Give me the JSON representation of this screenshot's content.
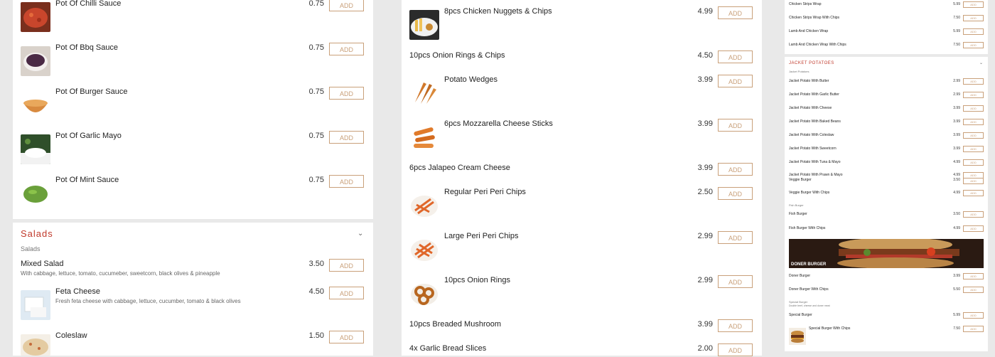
{
  "add_label": "ADD",
  "col1": {
    "sauces": [
      {
        "name": "Pot Of Chilli Sauce",
        "price": "0.75",
        "image": "chilli-sauce"
      },
      {
        "name": "Pot Of Bbq Sauce",
        "price": "0.75",
        "image": "bbq-sauce"
      },
      {
        "name": "Pot Of Burger Sauce",
        "price": "0.75",
        "image": "burger-sauce"
      },
      {
        "name": "Pot Of Garlic Mayo",
        "price": "0.75",
        "image": "garlic-mayo"
      },
      {
        "name": "Pot Of Mint Sauce",
        "price": "0.75",
        "image": "mint-sauce"
      }
    ],
    "salads": {
      "title": "Salads",
      "subtitle": "Salads",
      "items": [
        {
          "name": "Mixed Salad",
          "desc": "With cabbage, lettuce, tomato, cucumeber, sweetcorn, black olives & pineapple",
          "price": "3.50"
        },
        {
          "name": "Feta Cheese",
          "desc": "Fresh feta cheese with cabbage, lettuce, cucumber, tomato & black olives",
          "price": "4.50",
          "image": "feta"
        },
        {
          "name": "Coleslaw",
          "desc": "",
          "price": "1.50",
          "image": "coleslaw"
        }
      ]
    }
  },
  "col2": {
    "items": [
      {
        "name": "8pcs Chicken Nuggets & Chips",
        "price": "4.99",
        "image": "nuggets"
      },
      {
        "name": "10pcs Onion Rings & Chips",
        "price": "4.50"
      },
      {
        "name": "Potato Wedges",
        "price": "3.99",
        "image": "wedges"
      },
      {
        "name": "6pcs Mozzarella Cheese Sticks",
        "price": "3.99",
        "image": "mozzarella"
      },
      {
        "name": "6pcs Jalapeo Cream Cheese",
        "price": "3.99"
      },
      {
        "name": "Regular Peri Peri Chips",
        "price": "2.50",
        "image": "peri-chips"
      },
      {
        "name": "Large Peri Peri Chips",
        "price": "2.99",
        "image": "peri-chips-large"
      },
      {
        "name": "10pcs Onion Rings",
        "price": "2.99",
        "image": "onion-rings"
      },
      {
        "name": "10pcs Breaded Mushroom",
        "price": "3.99"
      },
      {
        "name": "4x Garlic Bread Slices",
        "price": "2.00"
      }
    ]
  },
  "col3": {
    "wraps": [
      {
        "name": "Chicken Strips Wrap",
        "price": "5.99"
      },
      {
        "name": "Chicken Strips Wrap With Chips",
        "price": "7.50"
      },
      {
        "name": "Lamb And Chicken Wrap",
        "price": "5.99"
      },
      {
        "name": "Lamb And Chicken Wrap With Chips",
        "price": "7.50"
      }
    ],
    "jacket": {
      "title": "JACKET POTATOES",
      "subtitle": "Jacket Potatoes",
      "items": [
        {
          "name": "Jacket Potato With Butter",
          "price": "2.99"
        },
        {
          "name": "Jacket Potato With Garlic Butter",
          "price": "2.99"
        },
        {
          "name": "Jacket Potato With Cheese",
          "price": "3.99"
        },
        {
          "name": "Jacket Potato With Baked Beans",
          "price": "3.99"
        },
        {
          "name": "Jacket Potato With Coleslaw",
          "price": "3.99"
        },
        {
          "name": "Jacket Potato With Sweetcorn",
          "price": "3.99"
        },
        {
          "name": "Jacket Potato With Tuna & Mayo",
          "price": "4.99"
        },
        {
          "name": "Jacket Potato With Prawn & Mayo",
          "price": "4.99"
        }
      ]
    },
    "burgers": {
      "veggie": [
        {
          "name": "Veggie Burger",
          "price": "3.50"
        },
        {
          "name": "Veggie Burger With Chips",
          "price": "4.99"
        }
      ],
      "fish_sub": "Fish Burger",
      "fish": [
        {
          "name": "Fish Burger",
          "price": "3.50"
        },
        {
          "name": "Fish Burger With Chips",
          "price": "4.99"
        }
      ],
      "banner": "DONER BURGER",
      "doner": [
        {
          "name": "Doner Burger",
          "price": "3.99"
        },
        {
          "name": "Doner Burger With Chips",
          "price": "5.50"
        }
      ],
      "special_sub": "Special Burger",
      "special_desc": "Double beef, cheese and doner meat",
      "special": [
        {
          "name": "Special Burger",
          "price": "5.99"
        },
        {
          "name": "Special Burger With Chips",
          "price": "7.50"
        }
      ]
    }
  }
}
